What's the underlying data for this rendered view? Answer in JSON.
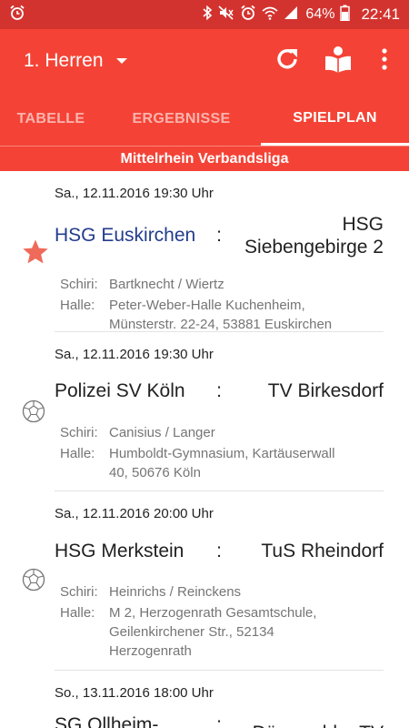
{
  "status_bar": {
    "battery": "64%",
    "time": "22:41",
    "icons": [
      "alarm-icon",
      "bluetooth-icon",
      "mute-icon",
      "alarm-clock-icon",
      "wifi-icon",
      "signal-icon",
      "battery-icon"
    ]
  },
  "app_bar": {
    "team": "1. Herren",
    "actions": [
      "refresh-icon",
      "reader-icon",
      "more-vert-icon"
    ]
  },
  "tabs": [
    {
      "label": "TABELLE",
      "active": false
    },
    {
      "label": "ERGEBNISSE",
      "active": false
    },
    {
      "label": "SPIELPLAN",
      "active": true
    }
  ],
  "league": "Mittelrhein Verbandsliga",
  "labels": {
    "referee": "Schiri:",
    "hall": "Halle:"
  },
  "matches": [
    {
      "date": "Sa., 12.11.2016 19:30 Uhr",
      "home": "HSG Euskirchen",
      "separator": ":",
      "away_line1": "HSG",
      "away_line2": "Siebengebirge 2",
      "referees": "Bartknecht / Wiertz",
      "hall_line1": "Peter-Weber-Halle Kuchenheim,",
      "hall_line2": "Münsterstr. 22-24, 53881 Euskirchen",
      "icon": "star-icon",
      "favorite": true
    },
    {
      "date": "Sa., 12.11.2016 19:30 Uhr",
      "home": "Polizei SV Köln",
      "separator": ":",
      "away": "TV Birkesdorf",
      "referees": "Canisius / Langer",
      "hall_line1": "Humboldt-Gymnasium, Kartäuserwall",
      "hall_line2": "40, 50676 Köln",
      "icon": "handball-icon"
    },
    {
      "date": "Sa., 12.11.2016 20:00 Uhr",
      "home": "HSG Merkstein",
      "separator": ":",
      "away": "TuS Rheindorf",
      "referees": "Heinrichs / Reinckens",
      "hall_line1": "M 2, Herzogenrath Gesamtschule,",
      "hall_line2": "Geilenkirchener Str., 52134",
      "hall_line3": "Herzogenrath",
      "icon": "handball-icon"
    },
    {
      "date": "So., 13.11.2016 18:00 Uhr",
      "home": "SG Ollheim-",
      "separator": ":",
      "away": "Dünnwalder TV"
    }
  ]
}
